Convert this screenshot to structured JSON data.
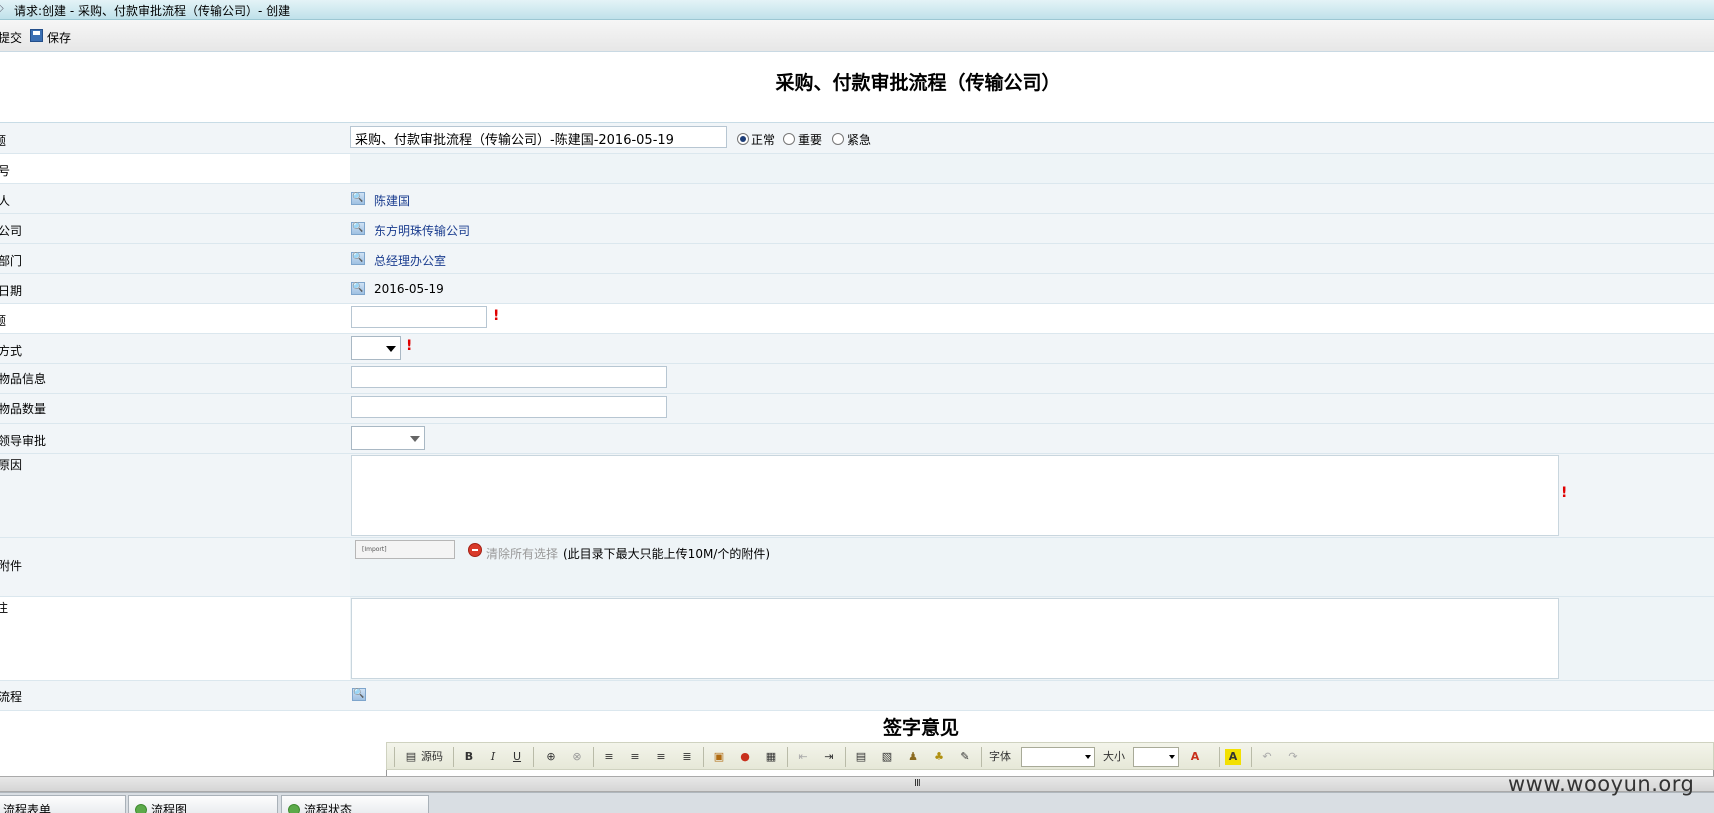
{
  "window": {
    "title": "请求:创建 - 采购、付款审批流程（传输公司）- 创建"
  },
  "toolbar": {
    "submit_label": "提交",
    "save_label": "保存"
  },
  "form": {
    "title": "采购、付款审批流程（传输公司）",
    "rows": {
      "title_field": {
        "label": "题",
        "value": "采购、付款审批流程（传输公司）-陈建国-2016-05-19"
      },
      "number": {
        "label": "号"
      },
      "applicant": {
        "label": "人",
        "value": "陈建国"
      },
      "company": {
        "label": "公司",
        "value": "东方明珠传输公司"
      },
      "department": {
        "label": "部门",
        "value": "总经理办公室"
      },
      "date": {
        "label": "日期",
        "value": "2016-05-19"
      },
      "amount": {
        "label": "题",
        "value": ""
      },
      "method": {
        "label": "方式",
        "value": ""
      },
      "goods_info": {
        "label": "物品信息",
        "value": ""
      },
      "goods_qty": {
        "label": "物品数量",
        "value": ""
      },
      "leader_approval": {
        "label": "领导审批",
        "value": ""
      },
      "reason": {
        "label": "原因",
        "value": ""
      },
      "attachment": {
        "label": "附件",
        "button_text": "[Import]",
        "clear_label": "清除所有选择",
        "note": "(此目录下最大只能上传10M/个的附件)"
      },
      "remark": {
        "label": "注",
        "value": ""
      },
      "related_flow": {
        "label": "流程"
      }
    },
    "priority": {
      "options": [
        "正常",
        "重要",
        "紧急"
      ],
      "selected": "正常"
    },
    "required_mark": "!"
  },
  "signature": {
    "title": "签字意见",
    "editor": {
      "source_label": "源码",
      "font_label": "字体",
      "size_label": "大小",
      "bold": "B",
      "italic": "I",
      "underline": "U",
      "font_color": "A",
      "bg_color": "A"
    }
  },
  "splitter": {
    "grip": "III"
  },
  "tabs": [
    "流程表单",
    "流程图",
    "流程状态"
  ],
  "watermark": "www.wooyun.org",
  "colors": {
    "accent_link": "#1b3d8f",
    "required": "#e00000",
    "row_alt": "#f1f5f8"
  }
}
